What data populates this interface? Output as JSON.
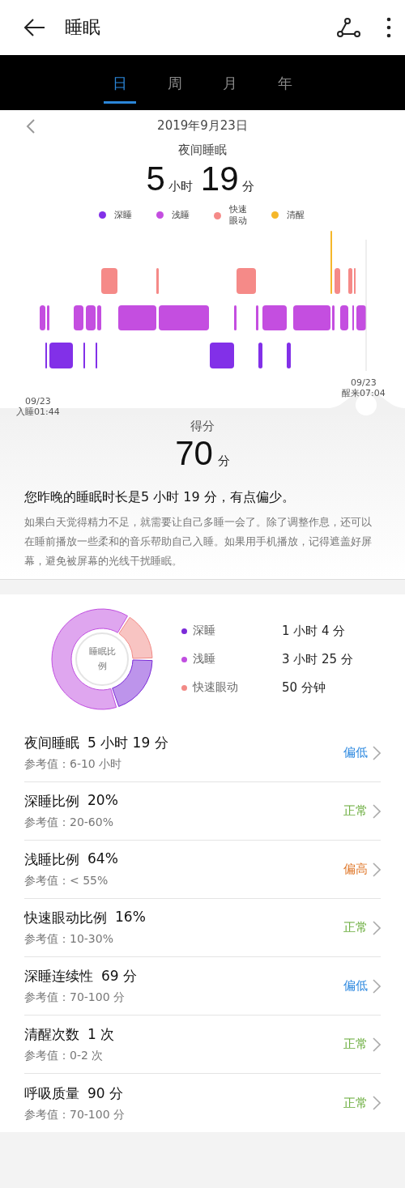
{
  "header": {
    "title": "睡眠"
  },
  "tabs": [
    {
      "label": "日",
      "selected": true
    },
    {
      "label": "周",
      "selected": false
    },
    {
      "label": "月",
      "selected": false
    },
    {
      "label": "年",
      "selected": false
    }
  ],
  "summary": {
    "date": "2019年9月23日",
    "title": "夜间睡眠",
    "hours": "5",
    "hours_unit": "小时",
    "minutes": "19",
    "minutes_unit": "分",
    "legend": [
      {
        "label": "深睡",
        "color": "#8230e8"
      },
      {
        "label": "浅睡",
        "color": "#c44ee0"
      },
      {
        "label": "快速眼动",
        "color": "#f58a88"
      },
      {
        "label": "清醒",
        "color": "#f5b72a"
      }
    ],
    "start_date": "09/23",
    "start_time": "入睡01:44",
    "end_date": "09/23",
    "end_time": "醒来07:04"
  },
  "score": {
    "label": "得分",
    "value": "70",
    "unit": "分",
    "headline": "您昨晚的睡眠时长是5 小时 19 分，有点偏少。",
    "advice": "如果白天觉得精力不足，就需要让自己多睡一会了。除了调整作息，还可以在睡前播放一些柔和的音乐帮助自己入睡。如果用手机播放，记得遮盖好屏幕，避免被屏幕的光线干扰睡眠。"
  },
  "ratio": {
    "center": "睡眠比例",
    "items": [
      {
        "label": "深睡",
        "value": "1 小时 4 分",
        "color": "#7b2ad8"
      },
      {
        "label": "浅睡",
        "value": "3 小时 25 分",
        "color": "#c04ee0"
      },
      {
        "label": "快速眼动",
        "value": "50 分钟",
        "color": "#f28a86"
      }
    ]
  },
  "metrics": [
    {
      "name": "夜间睡眠",
      "value": "5 小时 19 分",
      "reference": "参考值：6-10 小时",
      "status": "偏低",
      "color": "#2f8ae0"
    },
    {
      "name": "深睡比例",
      "value": "20%",
      "reference": "参考值：20-60%",
      "status": "正常",
      "color": "#6aac3c"
    },
    {
      "name": "浅睡比例",
      "value": "64%",
      "reference": "参考值：< 55%",
      "status": "偏高",
      "color": "#e07a2e"
    },
    {
      "name": "快速眼动比例",
      "value": "16%",
      "reference": "参考值：10-30%",
      "status": "正常",
      "color": "#6aac3c"
    },
    {
      "name": "深睡连续性",
      "value": "69 分",
      "reference": "参考值：70-100 分",
      "status": "偏低",
      "color": "#2f8ae0"
    },
    {
      "name": "清醒次数",
      "value": "1 次",
      "reference": "参考值：0-2 次",
      "status": "正常",
      "color": "#6aac3c"
    },
    {
      "name": "呼吸质量",
      "value": "90 分",
      "reference": "参考值：70-100 分",
      "status": "正常",
      "color": "#6aac3c"
    }
  ]
}
